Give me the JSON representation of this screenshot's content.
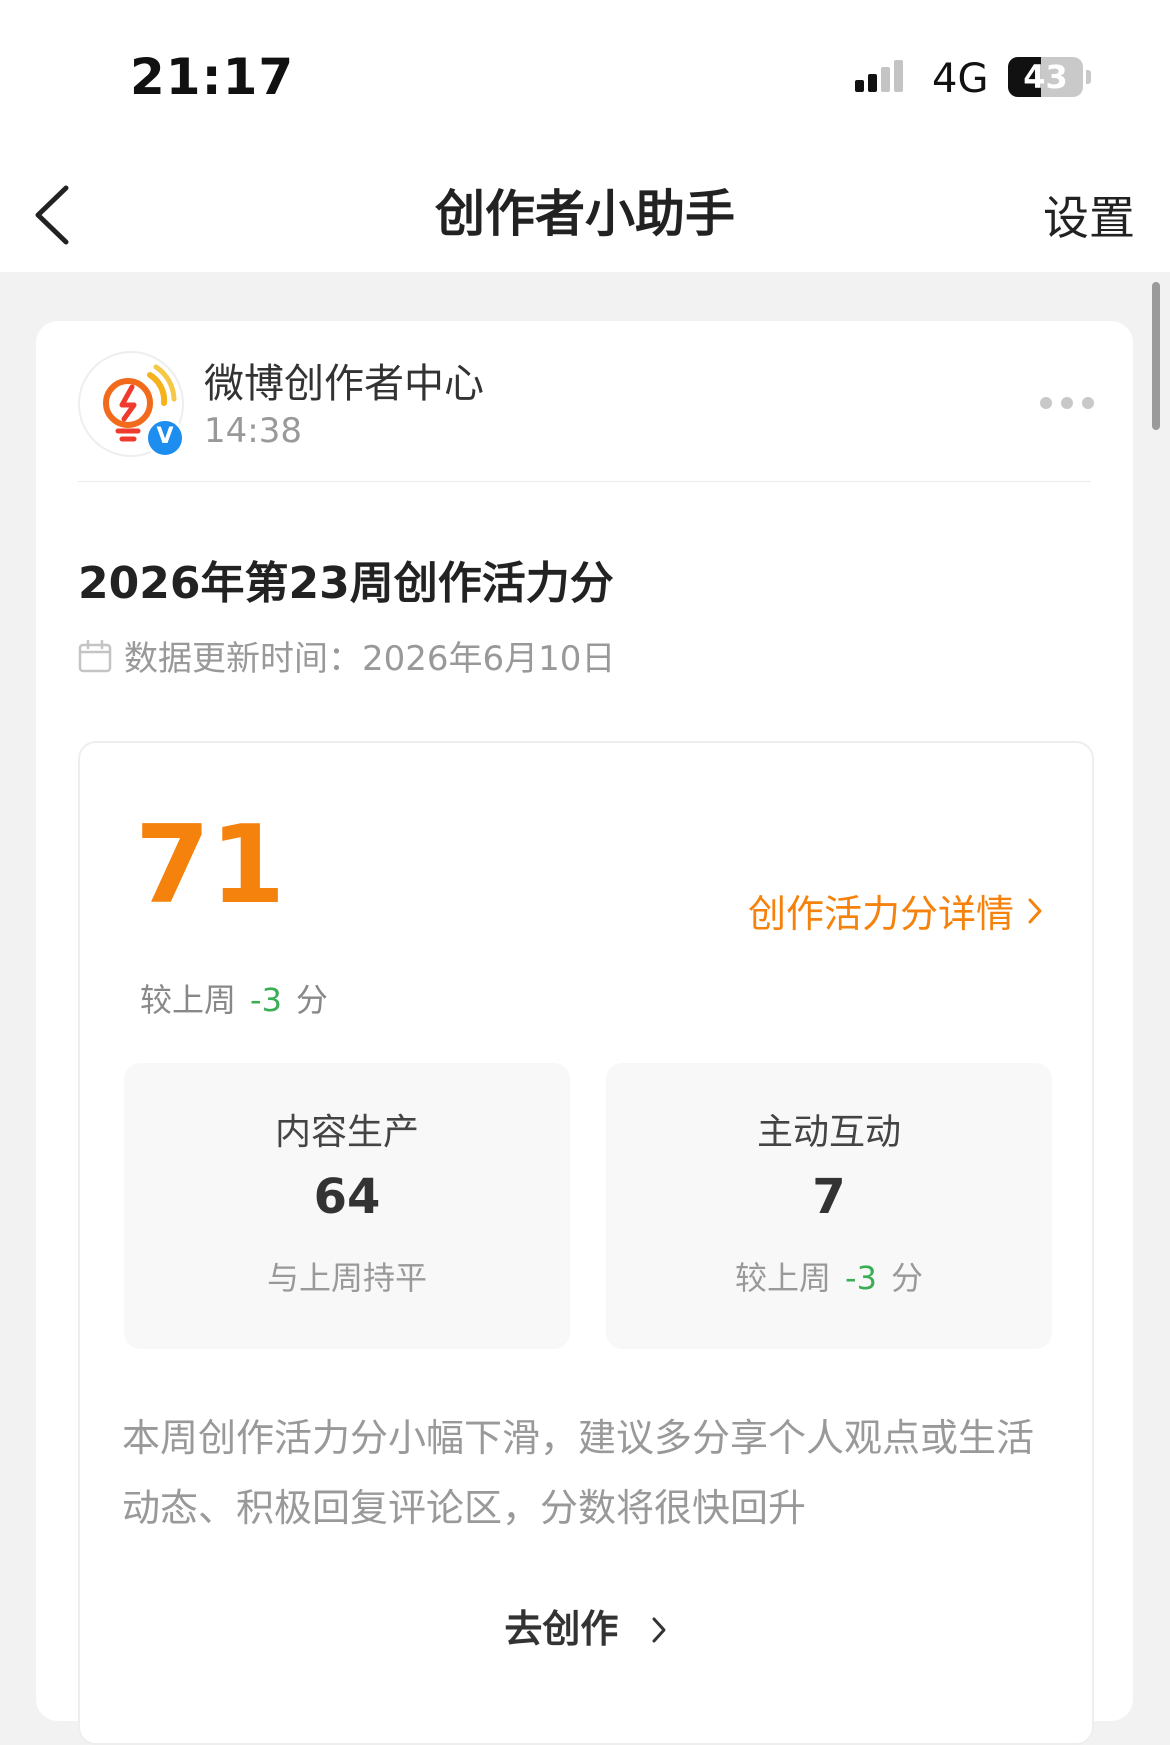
{
  "status_bar": {
    "time": "21:17",
    "network": "4G",
    "battery": "43"
  },
  "nav": {
    "title": "创作者小助手",
    "settings_label": "设置"
  },
  "message": {
    "sender_name": "微博创作者中心",
    "sent_time": "14:38",
    "verified_badge": "V",
    "title": "2026年第23周创作活力分",
    "update_label": "数据更新时间：",
    "update_date": "2026年6月10日",
    "score": "71",
    "detail_link": "创作活力分详情",
    "compare_prefix": "较上周",
    "compare_value": "-3",
    "compare_unit": "分",
    "metrics": [
      {
        "label": "内容生产",
        "value": "64",
        "note": "与上周持平"
      },
      {
        "label": "主动互动",
        "value": "7",
        "note_prefix": "较上周",
        "note_value": "-3",
        "note_unit": "分"
      }
    ],
    "description": "本周创作活力分小幅下滑，建议多分享个人观点或生活动态、积极回复评论区，分数将很快回升",
    "cta": "去创作"
  },
  "colors": {
    "accent": "#f5820c",
    "positive": "#3bad55",
    "verified": "#1e8df0",
    "background": "#f2f2f2"
  },
  "icons": [
    "back-chevron-icon",
    "signal-icon",
    "battery-icon",
    "lightbulb-logo-icon",
    "verified-icon",
    "more-icon",
    "calendar-icon",
    "chevron-right-icon"
  ]
}
